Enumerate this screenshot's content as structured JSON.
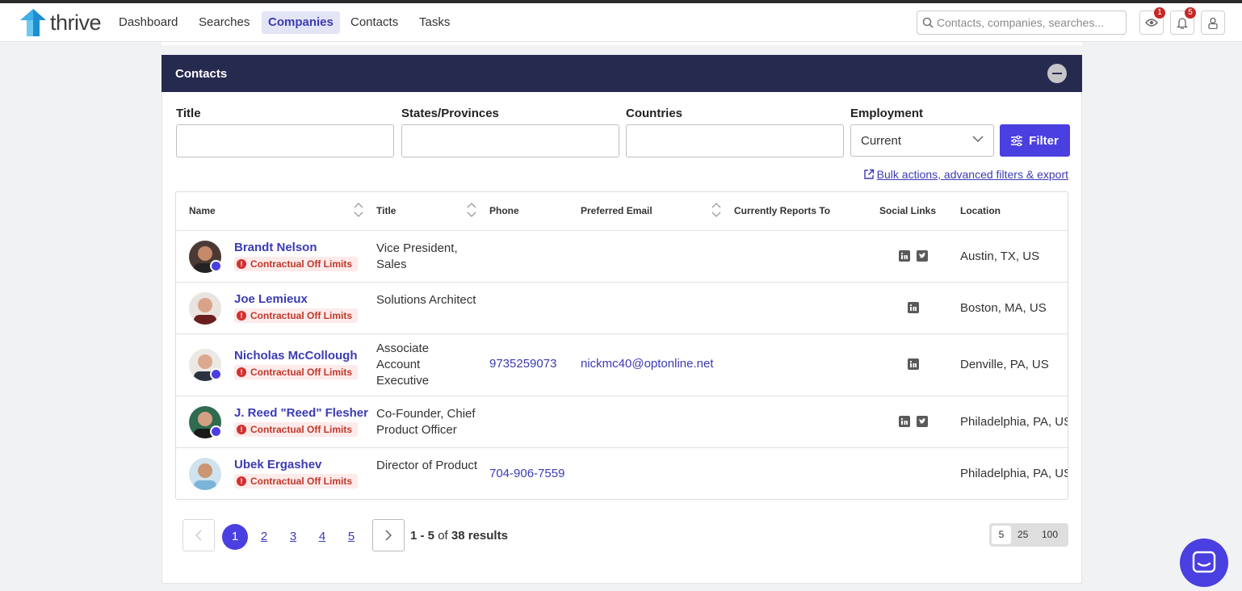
{
  "app": {
    "name": "thrive"
  },
  "nav": {
    "items": [
      "Dashboard",
      "Searches",
      "Companies",
      "Contacts",
      "Tasks"
    ],
    "active": "Companies"
  },
  "search": {
    "placeholder": "Contacts, companies, searches..."
  },
  "header_icons": [
    {
      "icon": "eye-icon",
      "badge": "1"
    },
    {
      "icon": "bell-icon",
      "badge": "5"
    },
    {
      "icon": "user-icon"
    }
  ],
  "panel": {
    "title": "Contacts"
  },
  "filters": {
    "title_label": "Title",
    "states_label": "States/Provinces",
    "countries_label": "Countries",
    "employment_label": "Employment",
    "employment_value": "Current",
    "filter_button": "Filter",
    "bulk_link": "Bulk actions, advanced filters & export"
  },
  "table": {
    "headers": [
      "Name",
      "Title",
      "Phone",
      "Preferred Email",
      "Currently Reports To",
      "Social Links",
      "Location"
    ],
    "rows": [
      {
        "name": "Brandt Nelson",
        "tag": "Contractual Off Limits",
        "title": "Vice President, Sales",
        "phone": "",
        "email": "",
        "reports_to": "",
        "social": [
          "linkedin",
          "twitter"
        ],
        "location": "Austin, TX, US",
        "verified": true
      },
      {
        "name": "Joe Lemieux",
        "tag": "Contractual Off Limits",
        "title": "Solutions Architect",
        "phone": "",
        "email": "",
        "reports_to": "",
        "social": [
          "linkedin"
        ],
        "location": "Boston, MA, US",
        "verified": false
      },
      {
        "name": "Nicholas McCollough",
        "tag": "Contractual Off Limits",
        "title": "Associate Account Executive",
        "phone": "9735259073",
        "email": "nickmc40@optonline.net",
        "reports_to": "",
        "social": [
          "linkedin"
        ],
        "location": "Denville, PA, US",
        "verified": true
      },
      {
        "name": "J. Reed \"Reed\" Flesher",
        "tag": "Contractual Off Limits",
        "title": "Co-Founder, Chief Product Officer",
        "phone": "",
        "email": "",
        "reports_to": "",
        "social": [
          "linkedin",
          "twitter"
        ],
        "location": "Philadelphia, PA, US",
        "verified": true
      },
      {
        "name": "Ubek Ergashev",
        "tag": "Contractual Off Limits",
        "title": "Director of Product",
        "phone": "704-906-7559",
        "email": "",
        "reports_to": "",
        "social": [],
        "location": "Philadelphia, PA, US",
        "verified": false
      }
    ]
  },
  "pagination": {
    "pages": [
      "1",
      "2",
      "3",
      "4",
      "5"
    ],
    "current": "1",
    "range": "1 - 5",
    "of": "of",
    "total": "38 results",
    "per_page_options": [
      "5",
      "25",
      "100"
    ],
    "per_page": "5"
  },
  "colors": {
    "accent": "#4a3fe0",
    "header_bg": "#272a4f",
    "link": "#3b3bb5",
    "danger": "#c0392b"
  }
}
